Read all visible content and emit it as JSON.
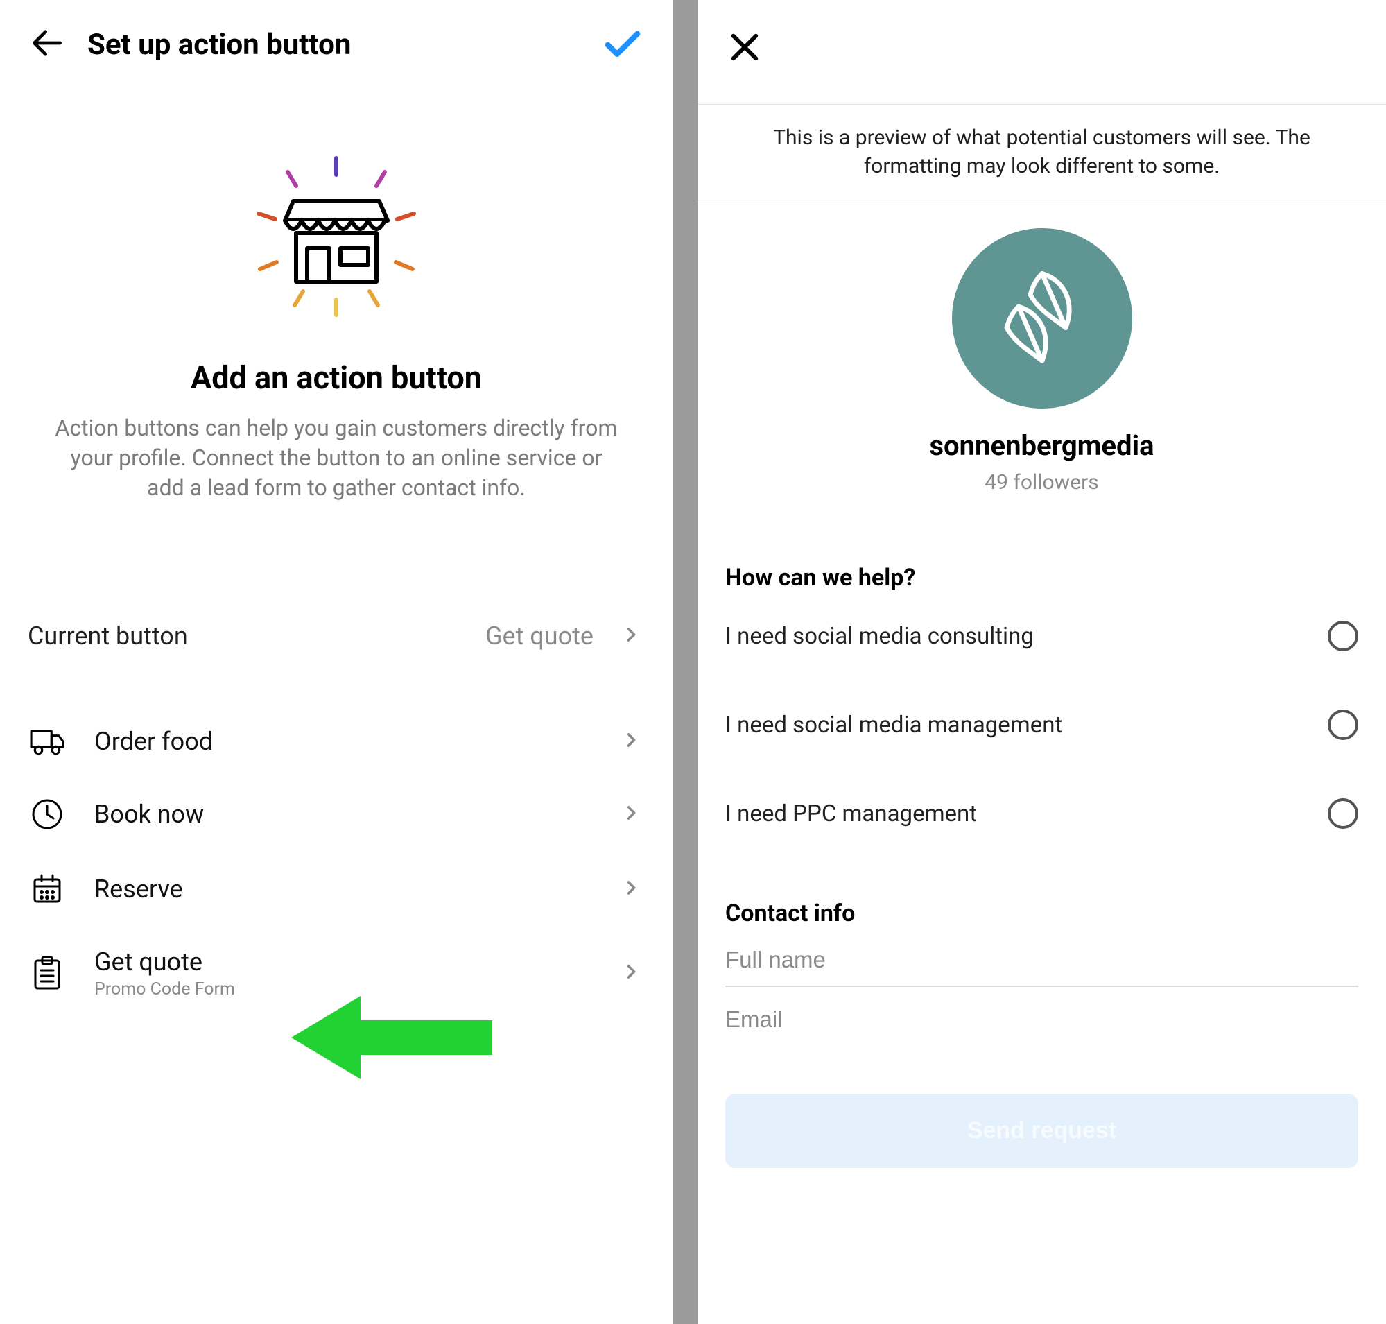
{
  "left": {
    "header_title": "Set up action button",
    "section_title": "Add an action button",
    "section_desc": "Action buttons can help you gain customers directly from your profile. Connect the button to an online service or add a lead form to gather contact info.",
    "current_label": "Current button",
    "current_value": "Get quote",
    "options": [
      {
        "label": "Order food",
        "sub": "",
        "icon": "truck-icon"
      },
      {
        "label": "Book now",
        "sub": "",
        "icon": "clock-icon"
      },
      {
        "label": "Reserve",
        "sub": "",
        "icon": "calendar-icon"
      },
      {
        "label": "Get quote",
        "sub": "Promo Code Form",
        "icon": "clipboard-icon"
      }
    ]
  },
  "right": {
    "preview_note": "This is a preview of what potential customers will see. The formatting may look different to some.",
    "profile_name": "sonnenbergmedia",
    "profile_meta": "49 followers",
    "question_title": "How can we help?",
    "choices": [
      "I need social media consulting",
      "I need social media management",
      "I need PPC management"
    ],
    "contact_title": "Contact info",
    "field_name_placeholder": "Full name",
    "field_email_placeholder": "Email",
    "submit_label": "Send request"
  }
}
